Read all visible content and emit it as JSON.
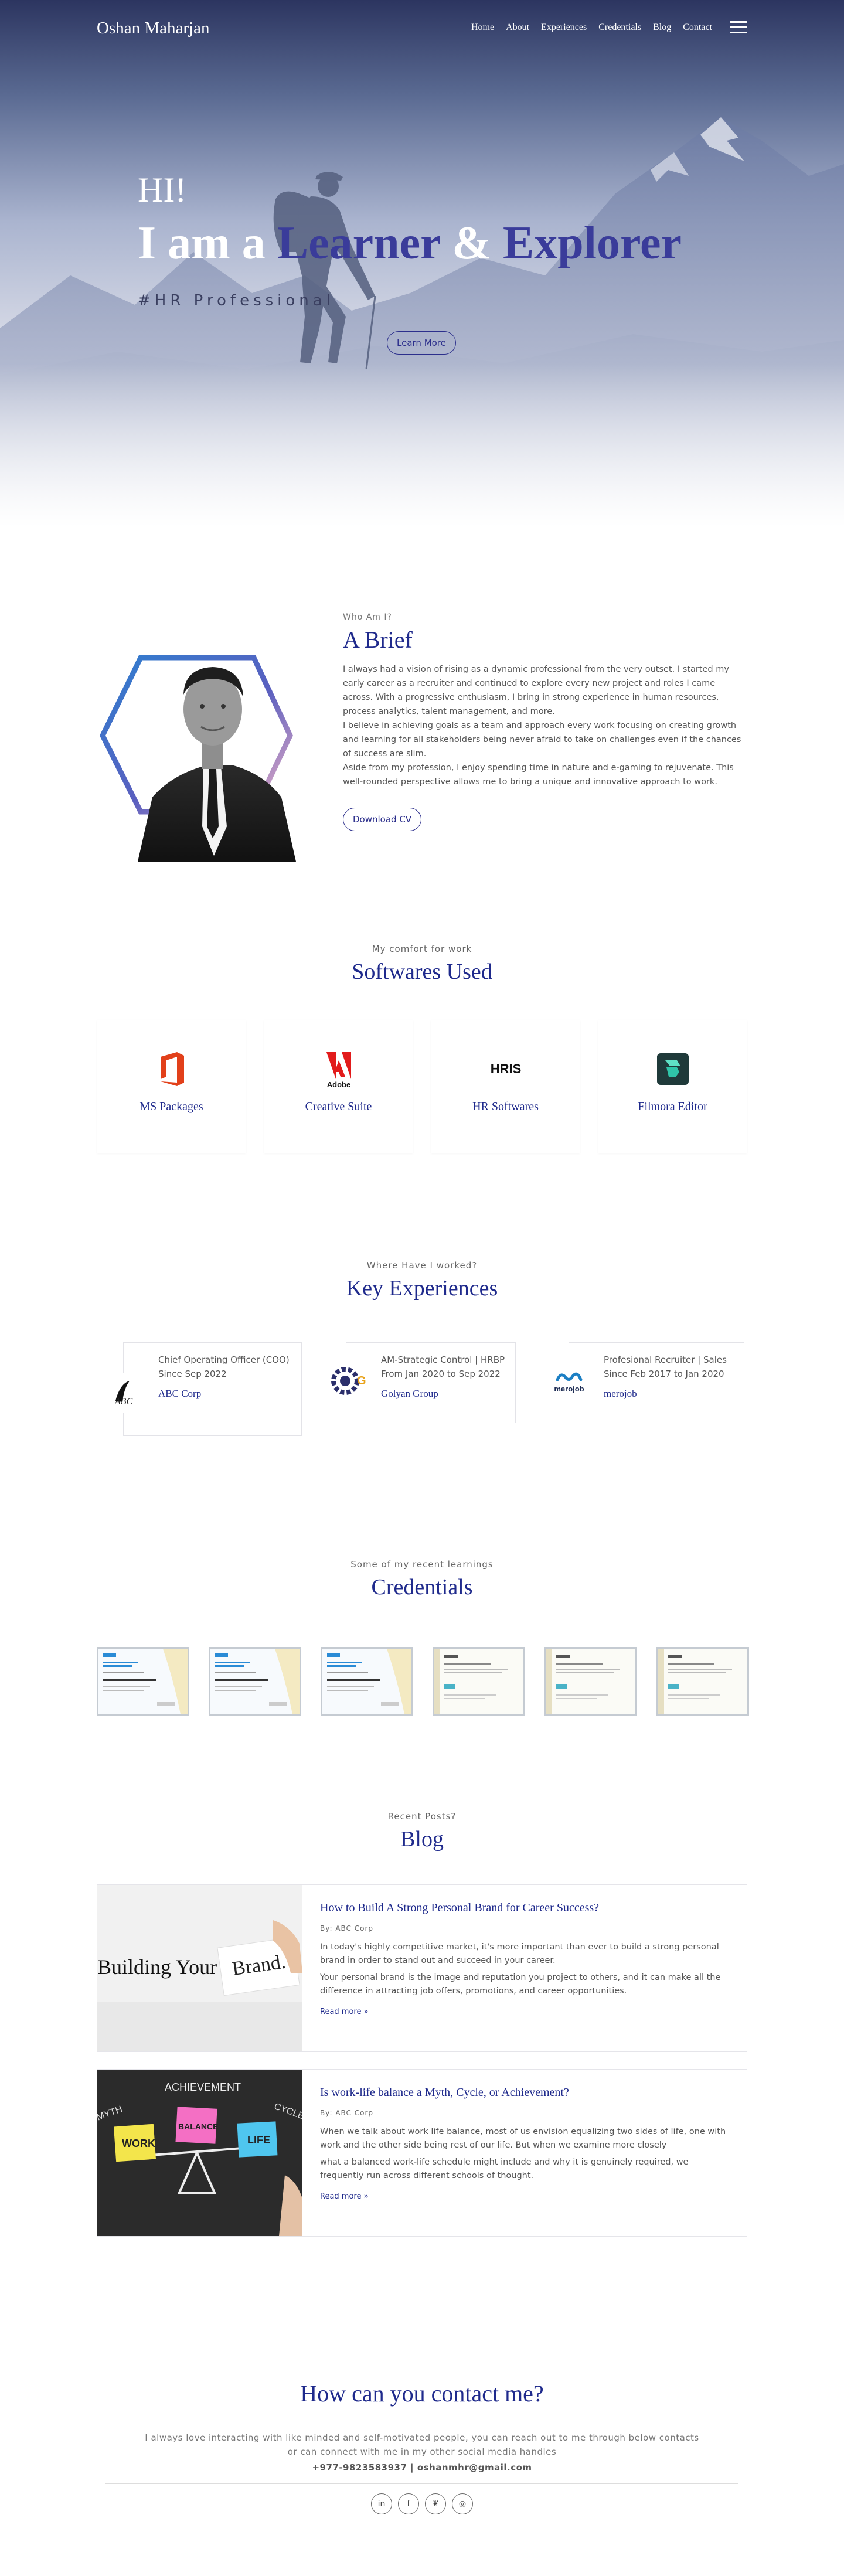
{
  "nav": {
    "brand": "Oshan Maharjan",
    "links": [
      "Home",
      "About",
      "Experiences",
      "Credentials",
      "Blog",
      "Contact"
    ],
    "menu_icon": "hamburger-icon"
  },
  "hero": {
    "greeting": "HI!",
    "line_prefix": "I am a",
    "word1": "Learner",
    "amp": "&",
    "word2": "Explorer",
    "subtitle": "#HR Professional",
    "button": "Learn More"
  },
  "about": {
    "eyebrow": "Who Am I?",
    "title": "A Brief",
    "paragraphs": [
      "I always had a vision of rising as a dynamic professional from the very outset. I started my early career as a recruiter and continued to explore every new project and roles I came across. With a progressive enthusiasm, I bring in strong experience in human resources, process analytics, talent management, and more.",
      "I believe in achieving goals as a team and approach every work focusing on creating growth and learning for all stakeholders being never afraid to take on challenges even if the chances of success are slim.",
      "Aside from my profession, I enjoy spending time in nature and e-gaming to rejuvenate. This well-rounded perspective allows me to bring a unique and innovative approach to work."
    ],
    "button": "Download CV"
  },
  "software": {
    "eyebrow": "My comfort for work",
    "title": "Softwares Used",
    "items": [
      {
        "label": "MS Packages",
        "icon": "ms-office-icon"
      },
      {
        "label": "Creative Suite",
        "icon": "adobe-icon"
      },
      {
        "label": "HR Softwares",
        "icon": "hris-icon"
      },
      {
        "label": "Filmora Editor",
        "icon": "filmora-icon"
      }
    ],
    "hris_text": "HRIS",
    "adobe_text": "Adobe"
  },
  "experience": {
    "eyebrow": "Where Have I worked?",
    "title": "Key Experiences",
    "items": [
      {
        "role": "Chief Operating Officer (COO)",
        "period": "Since Sep 2022",
        "company": "ABC Corp",
        "logo": "abc-logo-icon"
      },
      {
        "role": "AM-Strategic Control | HRBP",
        "period": "From Jan 2020 to Sep 2022",
        "company": "Golyan Group",
        "logo": "golyan-logo-icon"
      },
      {
        "role": "Profesional Recruiter | Sales",
        "period": "Since Feb 2017 to Jan 2020",
        "company": "merojob",
        "logo": "merojob-logo-icon"
      }
    ],
    "merojob_logo_text": "merojob"
  },
  "credentials": {
    "eyebrow": "Some of my recent learnings",
    "title": "Credentials",
    "count": 6
  },
  "blog": {
    "eyebrow": "Recent Posts?",
    "title": "Blog",
    "posts": [
      {
        "title": "How to Build A Strong Personal Brand for Career Success?",
        "by": "By: ABC Corp",
        "p1": "In today's highly competitive market, it's more important than ever to build a strong personal brand in order to stand out and succeed in your career.",
        "p2": "Your personal brand is the image and reputation you project to others, and it can make all the difference in attracting job offers, promotions, and career opportunities.",
        "more": "Read more »",
        "image_text_1": "Building Your",
        "image_text_2": "Brand."
      },
      {
        "title": "Is work-life balance a Myth, Cycle, or Achievement?",
        "by": "By: ABC Corp",
        "p1": "When we talk about work life balance, most of us envision equalizing two sides of life, one with work and the other side being rest of our life. But when we examine more closely",
        "p2": "what a balanced work-life schedule might include and why it is genuinely required, we frequently run across different schools of thought.",
        "more": "Read more »",
        "image_words": [
          "ACHIEVEMENT",
          "MYTH",
          "CYCLE",
          "WORK",
          "BALANCE",
          "LIFE"
        ]
      }
    ]
  },
  "contact": {
    "title": "How can you contact me?",
    "line1": "I always love interacting with like minded and self-motivated people, you can reach out to me through below contacts",
    "line2": "or can connect with me in my other social media handles",
    "info": "+977-9823583937 | oshanmhr@gmail.com",
    "socials": [
      {
        "name": "linkedin-icon",
        "glyph": "in"
      },
      {
        "name": "facebook-icon",
        "glyph": "f"
      },
      {
        "name": "twitter-icon",
        "glyph": "❦"
      },
      {
        "name": "instagram-icon",
        "glyph": "◎"
      }
    ]
  },
  "colors": {
    "accent": "#1f2a8c",
    "hero_word": "#3a3c9a",
    "hero_top": "#2c3560"
  }
}
